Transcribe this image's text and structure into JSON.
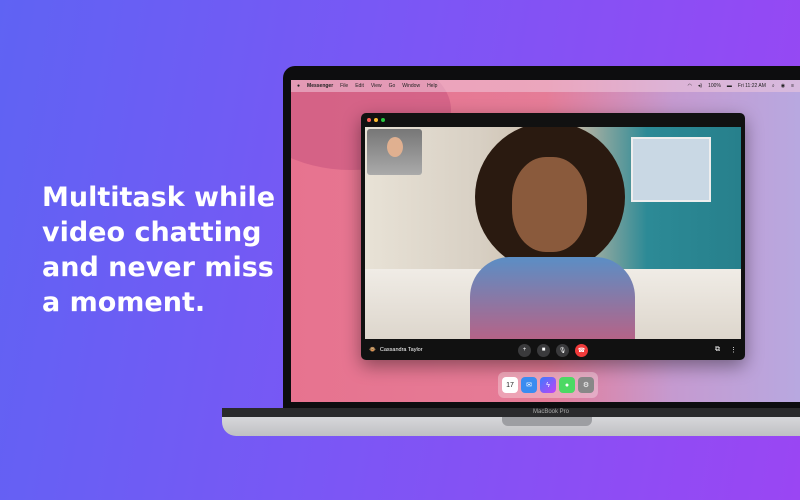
{
  "headline": "Multitask while video chatting and never miss a moment.",
  "menubar": {
    "app": "Messenger",
    "items": [
      "File",
      "Edit",
      "View",
      "Go",
      "Window",
      "Help"
    ],
    "battery": "100%",
    "clock": "Fri 11:22 AM"
  },
  "call": {
    "caller_name": "Cassandra Taylor",
    "buttons": [
      "add-person",
      "video",
      "microphone",
      "end-call"
    ]
  },
  "dock": {
    "calendar_day": "17",
    "apps": [
      "Calendar",
      "Mail",
      "Messenger",
      "Messages",
      "System Preferences"
    ]
  },
  "device_label": "MacBook Pro",
  "colors": {
    "end_call": "#f03a3a",
    "background_start": "#5f63f3",
    "background_end": "#9a46f3"
  }
}
